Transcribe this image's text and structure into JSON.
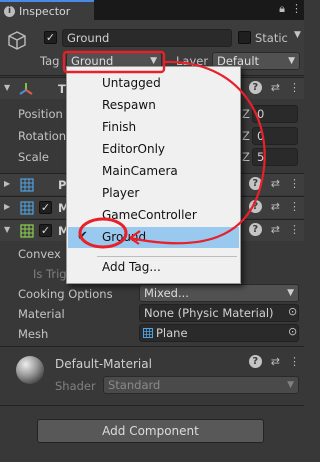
{
  "tab": {
    "title": "Inspector"
  },
  "header": {
    "object_name": "Ground",
    "static_label": "Static",
    "tag_label": "Tag",
    "tag_value": "Ground",
    "layer_label": "Layer",
    "layer_value": "Default"
  },
  "transform": {
    "title": "T",
    "rows": [
      {
        "label": "Position",
        "axis": "Z",
        "value": "0"
      },
      {
        "label": "Rotation",
        "axis": "Z",
        "value": "0"
      },
      {
        "label": "Scale",
        "axis": "Z",
        "value": "5"
      }
    ]
  },
  "components": [
    {
      "title": "P",
      "checked": false
    },
    {
      "title": "M",
      "checked": true
    },
    {
      "title": "M",
      "checked": true
    }
  ],
  "mesh_collider": {
    "convex_label": "Convex",
    "is_trigger_label": "Is Trig",
    "cooking_label": "Cooking Options",
    "cooking_value": "Mixed...",
    "material_label": "Material",
    "material_value": "None (Physic Material)",
    "mesh_label": "Mesh",
    "mesh_value": "Plane"
  },
  "material": {
    "name": "Default-Material",
    "shader_label": "Shader",
    "shader_value": "Standard"
  },
  "add_component_label": "Add Component",
  "tag_menu": {
    "items": [
      "Untagged",
      "Respawn",
      "Finish",
      "EditorOnly",
      "MainCamera",
      "Player",
      "GameController",
      "Ground"
    ],
    "selected": "Ground",
    "add_tag": "Add Tag..."
  },
  "colors": {
    "annotation": "#e8202a",
    "highlight": "#99c9ef",
    "background": "#383838"
  }
}
